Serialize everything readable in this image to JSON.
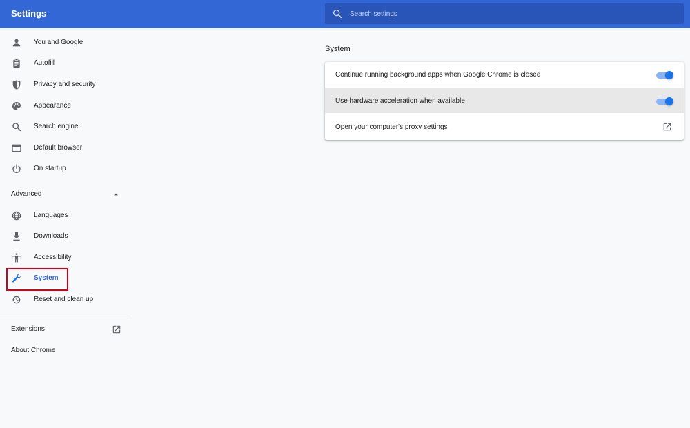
{
  "header": {
    "title": "Settings",
    "search_placeholder": "Search settings"
  },
  "sidebar": {
    "items": [
      {
        "label": "You and Google",
        "icon": "person-icon"
      },
      {
        "label": "Autofill",
        "icon": "clipboard-icon"
      },
      {
        "label": "Privacy and security",
        "icon": "shield-icon"
      },
      {
        "label": "Appearance",
        "icon": "palette-icon"
      },
      {
        "label": "Search engine",
        "icon": "search-icon"
      },
      {
        "label": "Default browser",
        "icon": "browser-window-icon"
      },
      {
        "label": "On startup",
        "icon": "power-icon"
      }
    ],
    "advanced": {
      "label": "Advanced",
      "expanded": true,
      "items": [
        {
          "label": "Languages",
          "icon": "globe-icon"
        },
        {
          "label": "Downloads",
          "icon": "download-icon"
        },
        {
          "label": "Accessibility",
          "icon": "accessibility-icon"
        },
        {
          "label": "System",
          "icon": "wrench-icon",
          "active": true
        },
        {
          "label": "Reset and clean up",
          "icon": "restore-icon"
        }
      ]
    },
    "extensions": {
      "label": "Extensions",
      "icon": "open-in-new-icon"
    },
    "about": {
      "label": "About Chrome"
    }
  },
  "main": {
    "section_title": "System",
    "rows": [
      {
        "label": "Continue running background apps when Google Chrome is closed",
        "control": "toggle",
        "checked": true
      },
      {
        "label": "Use hardware acceleration when available",
        "control": "toggle",
        "checked": true
      },
      {
        "label": "Open your computer's proxy settings",
        "control": "open-in-new-icon"
      }
    ]
  },
  "colors": {
    "header_bg": "#3367d6",
    "accent": "#1a73e8",
    "highlight": "#d0021b",
    "page_bg": "#f8f9fa"
  }
}
